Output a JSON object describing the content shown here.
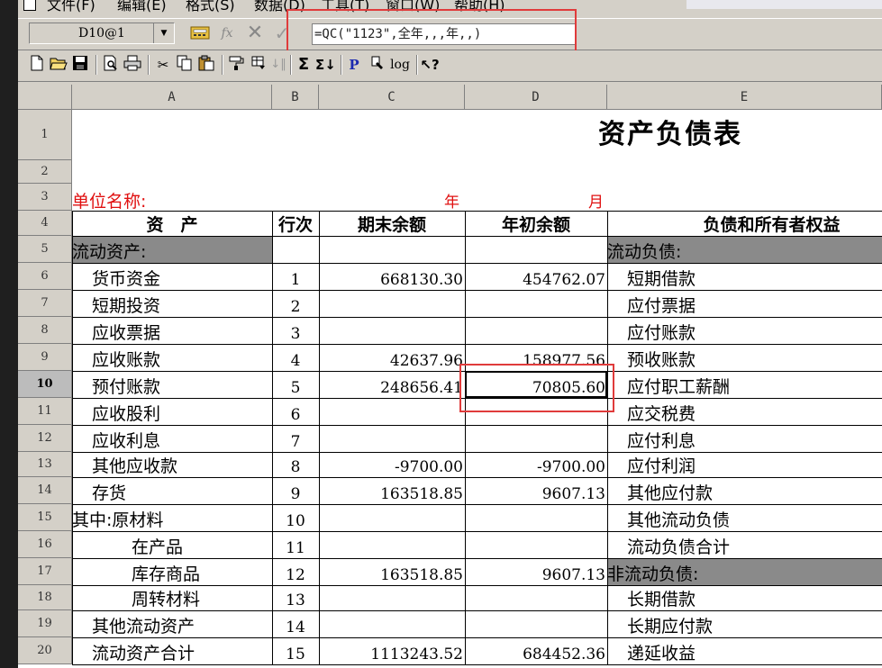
{
  "menubar": {
    "items": [
      "文件(F)",
      "编辑(E)",
      "格式(S)",
      "数据(D)",
      "工具(T)",
      "窗口(W)",
      "帮助(H)"
    ]
  },
  "formula_bar": {
    "cell_reference": "D10@1",
    "formula": "=QC(\"1123\",全年,,,年,,)",
    "buttons": [
      "function-editor",
      "fx",
      "cancel",
      "confirm"
    ]
  },
  "toolbar": {
    "icons": [
      "new-file-icon",
      "open-folder-icon",
      "save-icon",
      "print-preview-icon",
      "print-icon",
      "cut-icon",
      "copy-icon",
      "paste-icon",
      "format-painter-icon",
      "filter-icon",
      "sort-icon",
      "sum-icon",
      "sum-sort-icon",
      "p-icon",
      "insert-icon",
      "log-icon",
      "help-icon"
    ],
    "labels": {
      "p": "P",
      "log": "log",
      "help": "?",
      "sum": "Σ"
    }
  },
  "grid": {
    "columns": [
      "A",
      "B",
      "C",
      "D",
      "E"
    ],
    "rows": [
      "1",
      "2",
      "3",
      "4",
      "5",
      "6",
      "7",
      "8",
      "9",
      "10",
      "11",
      "12",
      "13",
      "14",
      "15",
      "16",
      "17",
      "18",
      "19",
      "20"
    ],
    "selected_row": "10",
    "selected_cell": "D10",
    "title": "资产负债表",
    "unit_label": "单位名称:",
    "year_label": "年",
    "month_label": "月",
    "headers": {
      "asset": "资　产",
      "line_no": "行次",
      "end_balance": "期末余额",
      "start_balance": "年初余额",
      "liability": "负债和所有者权益"
    },
    "assets": [
      {
        "name": "流动资产:",
        "line": "",
        "end": "",
        "start": ""
      },
      {
        "name": "  货币资金",
        "line": "1",
        "end": "668130.30",
        "start": "454762.07"
      },
      {
        "name": "  短期投资",
        "line": "2",
        "end": "",
        "start": ""
      },
      {
        "name": "  应收票据",
        "line": "3",
        "end": "",
        "start": ""
      },
      {
        "name": "  应收账款",
        "line": "4",
        "end": "42637.96",
        "start": "158977.56"
      },
      {
        "name": "  预付账款",
        "line": "5",
        "end": "248656.41",
        "start": "70805.60"
      },
      {
        "name": "  应收股利",
        "line": "6",
        "end": "",
        "start": ""
      },
      {
        "name": "  应收利息",
        "line": "7",
        "end": "",
        "start": ""
      },
      {
        "name": "  其他应收款",
        "line": "8",
        "end": "-9700.00",
        "start": "-9700.00"
      },
      {
        "name": "  存货",
        "line": "9",
        "end": "163518.85",
        "start": "9607.13"
      },
      {
        "name": "其中:原材料",
        "line": "10",
        "end": "",
        "start": ""
      },
      {
        "name": "      在产品",
        "line": "11",
        "end": "",
        "start": ""
      },
      {
        "name": "      库存商品",
        "line": "12",
        "end": "163518.85",
        "start": "9607.13"
      },
      {
        "name": "      周转材料",
        "line": "13",
        "end": "",
        "start": ""
      },
      {
        "name": "  其他流动资产",
        "line": "14",
        "end": "",
        "start": ""
      },
      {
        "name": "  流动资产合计",
        "line": "15",
        "end": "1113243.52",
        "start": "684452.36"
      }
    ],
    "liabilities": [
      "流动负债:",
      "  短期借款",
      "  应付票据",
      "  应付账款",
      "  预收账款",
      "  应付职工薪酬",
      "  应交税费",
      "  应付利息",
      "  应付利润",
      "  其他应付款",
      "  其他流动负债",
      "  流动负债合计",
      "非流动负债:",
      "  长期借款",
      "  长期应付款",
      "  递延收益"
    ]
  },
  "colors": {
    "highlight_box": "#e03b3b",
    "red_text": "#e01010",
    "shaded": "#8a8a8a"
  }
}
